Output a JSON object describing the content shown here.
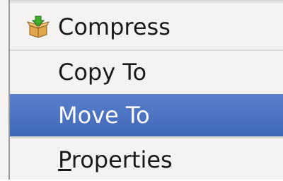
{
  "menu": {
    "items": [
      {
        "label": "Compress",
        "icon": "compress-box-icon"
      },
      {
        "label": "Copy To"
      },
      {
        "label": "Move To",
        "selected": true
      },
      {
        "label_mnemonic": "P",
        "label_rest": "roperties"
      }
    ]
  },
  "colors": {
    "selected_bg": "#4a73c2",
    "menu_bg": "#f4f3f2",
    "text": "#1a1a1a",
    "selected_text": "#ffffff"
  }
}
